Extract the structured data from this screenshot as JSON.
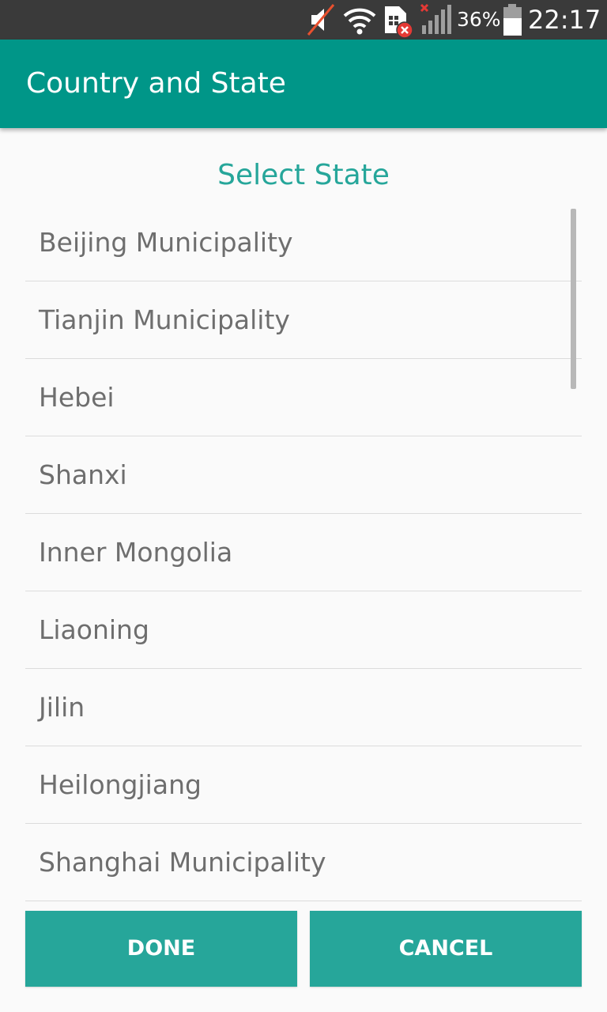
{
  "status_bar": {
    "battery_percent": "36%",
    "time": "22:17",
    "icons": [
      "mute-icon",
      "wifi-icon",
      "sim-error-icon",
      "signal-no-service-icon",
      "battery-icon"
    ]
  },
  "toolbar": {
    "title": "Country and State"
  },
  "dialog": {
    "title": "Select State",
    "items": [
      {
        "label": "Beijing Municipality"
      },
      {
        "label": "Tianjin Municipality"
      },
      {
        "label": "Hebei"
      },
      {
        "label": "Shanxi"
      },
      {
        "label": "Inner Mongolia"
      },
      {
        "label": "Liaoning"
      },
      {
        "label": "Jilin"
      },
      {
        "label": "Heilongjiang"
      },
      {
        "label": "Shanghai Municipality"
      }
    ],
    "done_label": "DONE",
    "cancel_label": "CANCEL"
  },
  "colors": {
    "toolbar": "#009688",
    "accent": "#26a69a",
    "status_bar": "#3a3a3a",
    "error": "#e53935"
  }
}
